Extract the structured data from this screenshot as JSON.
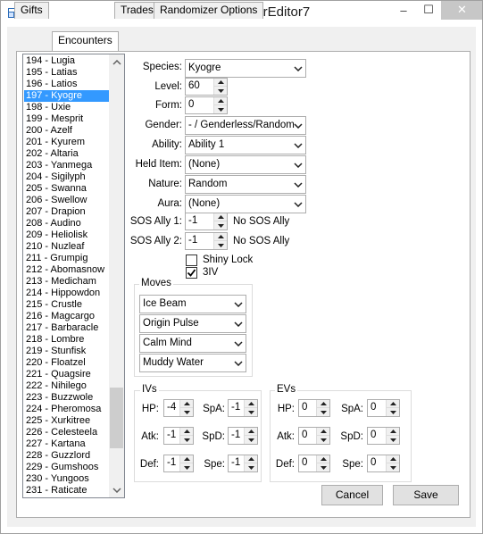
{
  "window": {
    "title": "StaticEncounterEditor7",
    "minimize": "–",
    "maximize": "☐",
    "close": "✕",
    "accent": "#3399ff"
  },
  "tabs": [
    "Gifts",
    "Encounters",
    "Trades",
    "Randomizer Options"
  ],
  "list": {
    "items": [
      "194 - Lugia",
      "195 - Latias",
      "196 - Latios",
      "197 - Kyogre",
      "198 - Uxie",
      "199 - Mesprit",
      "200 - Azelf",
      "201 - Kyurem",
      "202 - Altaria",
      "203 - Yanmega",
      "204 - Sigilyph",
      "205 - Swanna",
      "206 - Swellow",
      "207 - Drapion",
      "208 - Audino",
      "209 - Heliolisk",
      "210 - Nuzleaf",
      "211 - Grumpig",
      "212 - Abomasnow",
      "213 - Medicham",
      "214 - Hippowdon",
      "215 - Crustle",
      "216 - Magcargo",
      "217 - Barbaracle",
      "218 - Lombre",
      "219 - Stunfisk",
      "220 - Floatzel",
      "221 - Quagsire",
      "222 - Nihilego",
      "223 - Buzzwole",
      "224 - Pheromosa",
      "225 - Xurkitree",
      "226 - Celesteela",
      "227 - Kartana",
      "228 - Guzzlord",
      "229 - Gumshoos",
      "230 - Yungoos",
      "231 - Raticate"
    ],
    "selected": "197 - Kyogre"
  },
  "form": {
    "species_label": "Species:",
    "species": "Kyogre",
    "level_label": "Level:",
    "level": "60",
    "form_label": "Form:",
    "form": "0",
    "gender_label": "Gender:",
    "gender": "- / Genderless/Random",
    "ability_label": "Ability:",
    "ability": "Ability 1",
    "held_item_label": "Held Item:",
    "held_item": "(None)",
    "nature_label": "Nature:",
    "nature": "Random",
    "aura_label": "Aura:",
    "aura": "(None)",
    "sos1_label": "SOS Ally 1:",
    "sos1": "-1",
    "sos1_text": "No SOS Ally",
    "sos2_label": "SOS Ally 2:",
    "sos2": "-1",
    "sos2_text": "No SOS Ally",
    "shiny_lock_label": "Shiny Lock",
    "shiny_lock_checked": false,
    "three_iv_label": "3IV",
    "three_iv_checked": true
  },
  "moves": {
    "title": "Moves",
    "list": [
      "Ice Beam",
      "Origin Pulse",
      "Calm Mind",
      "Muddy Water"
    ]
  },
  "ivs": {
    "title": "IVs",
    "hp_label": "HP:",
    "hp": "-4",
    "atk_label": "Atk:",
    "atk": "-1",
    "def_label": "Def:",
    "def": "-1",
    "spa_label": "SpA:",
    "spa": "-1",
    "spd_label": "SpD:",
    "spd": "-1",
    "spe_label": "Spe:",
    "spe": "-1"
  },
  "evs": {
    "title": "EVs",
    "hp_label": "HP:",
    "hp": "0",
    "atk_label": "Atk:",
    "atk": "0",
    "def_label": "Def:",
    "def": "0",
    "spa_label": "SpA:",
    "spa": "0",
    "spd_label": "SpD:",
    "spd": "0",
    "spe_label": "Spe:",
    "spe": "0"
  },
  "buttons": {
    "cancel": "Cancel",
    "save": "Save"
  }
}
